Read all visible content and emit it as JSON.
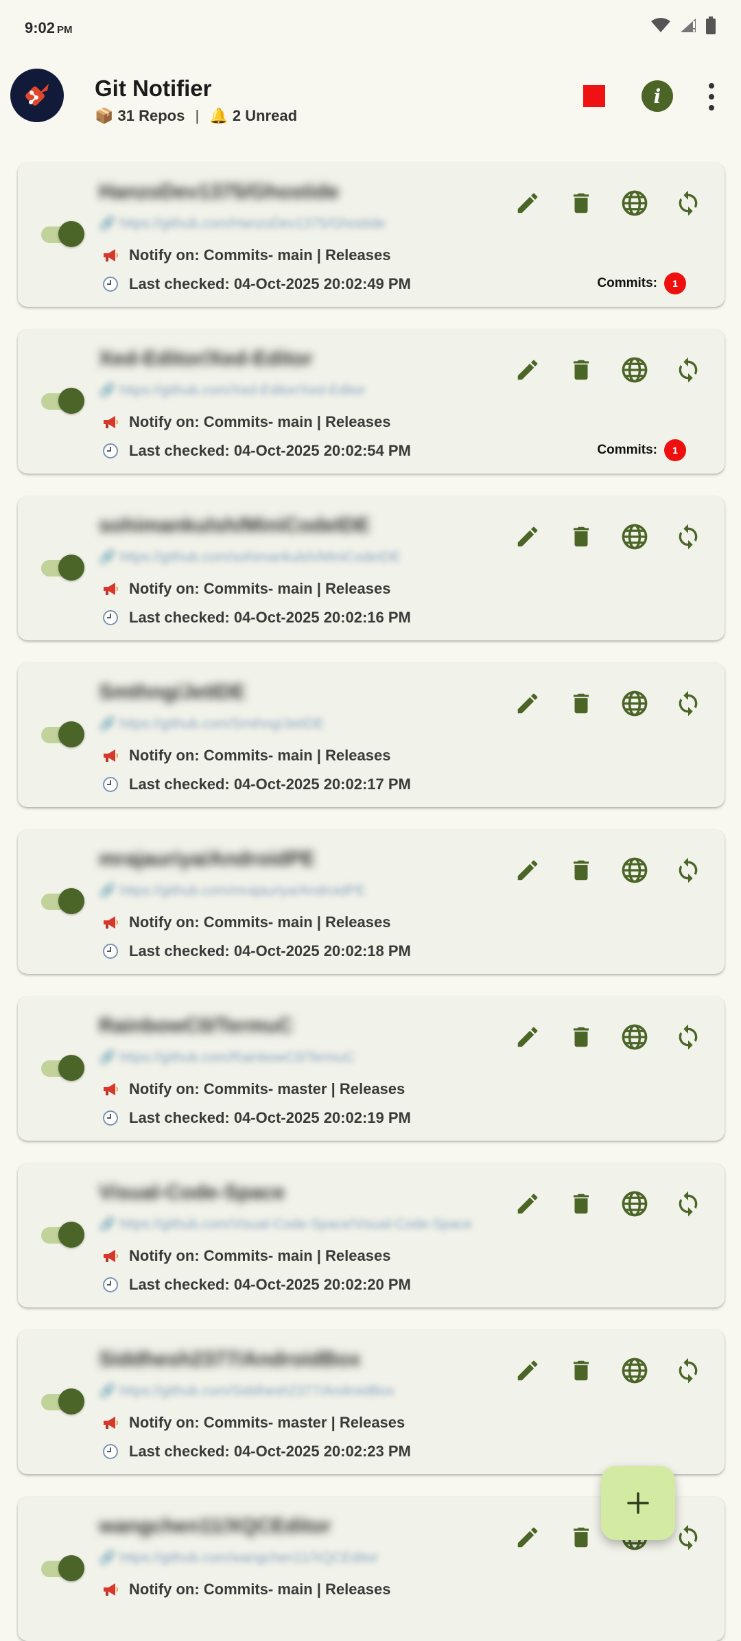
{
  "status_bar": {
    "time": "9:02",
    "ampm": "PM"
  },
  "header": {
    "title": "Git Notifier",
    "repos_icon": "📦",
    "repos_text": "31 Repos",
    "separator": "|",
    "unread_icon": "🔔",
    "unread_text": "2 Unread",
    "info_glyph": "i"
  },
  "colors": {
    "accent": "#4b6527",
    "track": "#c2d29b",
    "card": "#f1f2e9",
    "badge": "#ee0f0f",
    "stop": "#ee1212",
    "fab": "#d3eaa3"
  },
  "repos": [
    {
      "name": "HanzoDev1375/Ghostide",
      "url": "https://github.com/HanzoDev1375/Ghostide",
      "notify": "Notify on: Commits- main | Releases",
      "checked": "Last checked: 04-Oct-2025 20:02:49 PM",
      "enabled": true,
      "badge_label": "Commits:",
      "badge_count": "1"
    },
    {
      "name": "Xed-Editor/Xed-Editor",
      "url": "https://github.com/Xed-Editor/Xed-Editor",
      "notify": "Notify on: Commits- main | Releases",
      "checked": "Last checked: 04-Oct-2025 20:02:54 PM",
      "enabled": true,
      "badge_label": "Commits:",
      "badge_count": "1"
    },
    {
      "name": "sohimankulsh/MiniCodeIDE",
      "url": "https://github.com/sohimankulsh/MiniCodeIDE",
      "notify": "Notify on: Commits- main | Releases",
      "checked": "Last checked: 04-Oct-2025 20:02:16 PM",
      "enabled": true
    },
    {
      "name": "Smthng/JetIDE",
      "url": "https://github.com/Smthng/JetIDE",
      "notify": "Notify on: Commits- main | Releases",
      "checked": "Last checked: 04-Oct-2025 20:02:17 PM",
      "enabled": true
    },
    {
      "name": "mrajauriya/AndroidPE",
      "url": "https://github.com/mrajauriya/AndroidPE",
      "notify": "Notify on: Commits- main | Releases",
      "checked": "Last checked: 04-Oct-2025 20:02:18 PM",
      "enabled": true
    },
    {
      "name": "RainbowC0/TermuC",
      "url": "https://github.com/RainbowC0/TermuC",
      "notify": "Notify on: Commits- master | Releases",
      "checked": "Last checked: 04-Oct-2025 20:02:19 PM",
      "enabled": true
    },
    {
      "name": "Visual-Code-Space",
      "url": "https://github.com/Visual-Code-Space/Visual-Code-Space",
      "notify": "Notify on: Commits- main | Releases",
      "checked": "Last checked: 04-Oct-2025 20:02:20 PM",
      "enabled": true
    },
    {
      "name": "Siddhesh2377/AndroidBox",
      "url": "https://github.com/Siddhesh2377/AndroidBox",
      "notify": "Notify on: Commits- master | Releases",
      "checked": "Last checked: 04-Oct-2025 20:02:23 PM",
      "enabled": true
    },
    {
      "name": "wangchen11/XQCEditor",
      "url": "https://github.com/wangchen11/XQCEditor",
      "notify": "Notify on: Commits- main | Releases",
      "checked": "",
      "enabled": true
    }
  ]
}
